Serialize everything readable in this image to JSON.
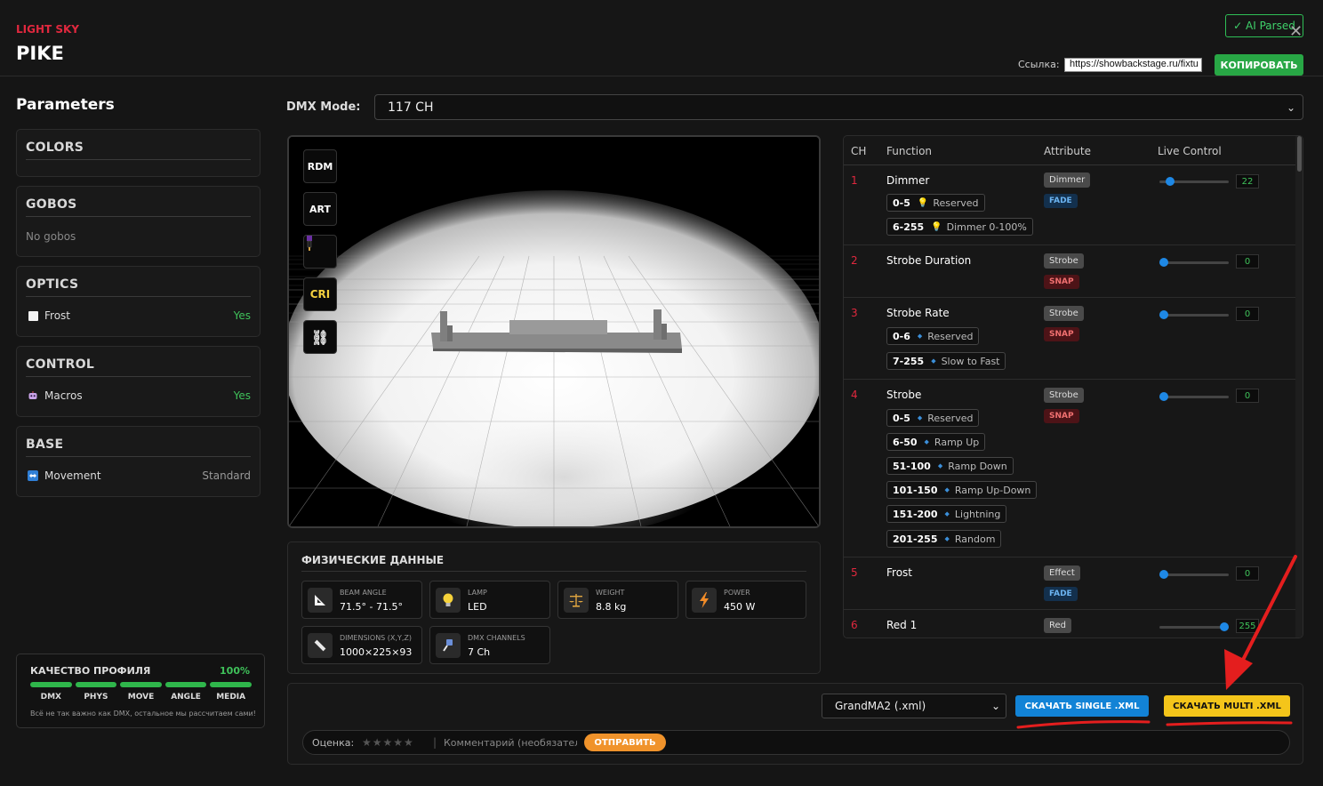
{
  "header": {
    "brand": "LIGHT SKY",
    "model": "PIKE",
    "ai_badge": "✓ AI Parsed",
    "link_label": "Ссылка:",
    "link_value": "https://showbackstage.ru/fixtu",
    "copy_label": "КОПИРОВАТЬ"
  },
  "sidebar": {
    "title": "Parameters",
    "colors": {
      "title": "COLORS"
    },
    "gobos": {
      "title": "GOBOS",
      "empty": "No gobos"
    },
    "optics": {
      "title": "OPTICS",
      "row_label": "Frost",
      "row_value": "Yes"
    },
    "control": {
      "title": "CONTROL",
      "row_label": "Macros",
      "row_value": "Yes"
    },
    "base": {
      "title": "BASE",
      "row_label": "Movement",
      "row_value": "Standard"
    }
  },
  "quality": {
    "title": "КАЧЕСТВО ПРОФИЛЯ",
    "percent": "100%",
    "labels": [
      "DMX",
      "PHYS",
      "MOVE",
      "ANGLE",
      "MEDIA"
    ],
    "note": "Всё не так важно как DMX, остальное мы рассчитаем сами!"
  },
  "dmx_mode": {
    "label": "DMX Mode:",
    "value": "117 CH"
  },
  "viewport_tools": {
    "rdm": "RDM",
    "art": "ART",
    "cri": "CRI"
  },
  "physical": {
    "title": "ФИЗИЧЕСКИЕ ДАННЫЕ",
    "cards": [
      {
        "label": "BEAM ANGLE",
        "value": "71.5° - 71.5°"
      },
      {
        "label": "LAMP",
        "value": "LED"
      },
      {
        "label": "WEIGHT",
        "value": "8.8 kg"
      },
      {
        "label": "POWER",
        "value": "450 W"
      },
      {
        "label": "DIMENSIONS (X,Y,Z)",
        "value": "1000×225×93"
      },
      {
        "label": "DMX CHANNELS",
        "value": "7 Ch"
      }
    ]
  },
  "channels": {
    "headers": {
      "ch": "CH",
      "function": "Function",
      "attribute": "Attribute",
      "live": "Live Control"
    },
    "rows": [
      {
        "ch": "1",
        "function": "Dimmer",
        "attr": "Dimmer",
        "tag": "FADE",
        "value": "22",
        "ranges": [
          {
            "r": "0-5",
            "l": "Reserved"
          },
          {
            "r": "6-255",
            "l": "Dimmer 0-100%"
          }
        ]
      },
      {
        "ch": "2",
        "function": "Strobe Duration",
        "attr": "Strobe",
        "tag": "SNAP",
        "value": "0",
        "ranges": []
      },
      {
        "ch": "3",
        "function": "Strobe Rate",
        "attr": "Strobe",
        "tag": "SNAP",
        "value": "0",
        "ranges": [
          {
            "r": "0-6",
            "l": "Reserved"
          },
          {
            "r": "7-255",
            "l": "Slow to Fast"
          }
        ]
      },
      {
        "ch": "4",
        "function": "Strobe",
        "attr": "Strobe",
        "tag": "SNAP",
        "value": "0",
        "ranges": [
          {
            "r": "0-5",
            "l": "Reserved"
          },
          {
            "r": "6-50",
            "l": "Ramp Up"
          },
          {
            "r": "51-100",
            "l": "Ramp Down"
          },
          {
            "r": "101-150",
            "l": "Ramp Up-Down"
          },
          {
            "r": "151-200",
            "l": "Lightning"
          },
          {
            "r": "201-255",
            "l": "Random"
          }
        ]
      },
      {
        "ch": "5",
        "function": "Frost",
        "attr": "Effect",
        "tag": "FADE",
        "value": "0",
        "ranges": []
      },
      {
        "ch": "6",
        "function": "Red 1",
        "attr": "Red",
        "tag": "",
        "value": "255",
        "ranges": []
      }
    ]
  },
  "export": {
    "format": "GrandMA2 (.xml)",
    "single_label": "СКАЧАТЬ SINGLE .XML",
    "multi_label": "СКАЧАТЬ MULTI .XML",
    "rating_label": "Оценка:",
    "comment_placeholder": "Комментарий (необязательно)",
    "send_label": "ОТПРАВИТЬ"
  },
  "colors": {
    "accent_red": "#e0283e",
    "green": "#28a745",
    "blue": "#1283d6",
    "yellow": "#f4c51a",
    "orange": "#f0932b"
  }
}
